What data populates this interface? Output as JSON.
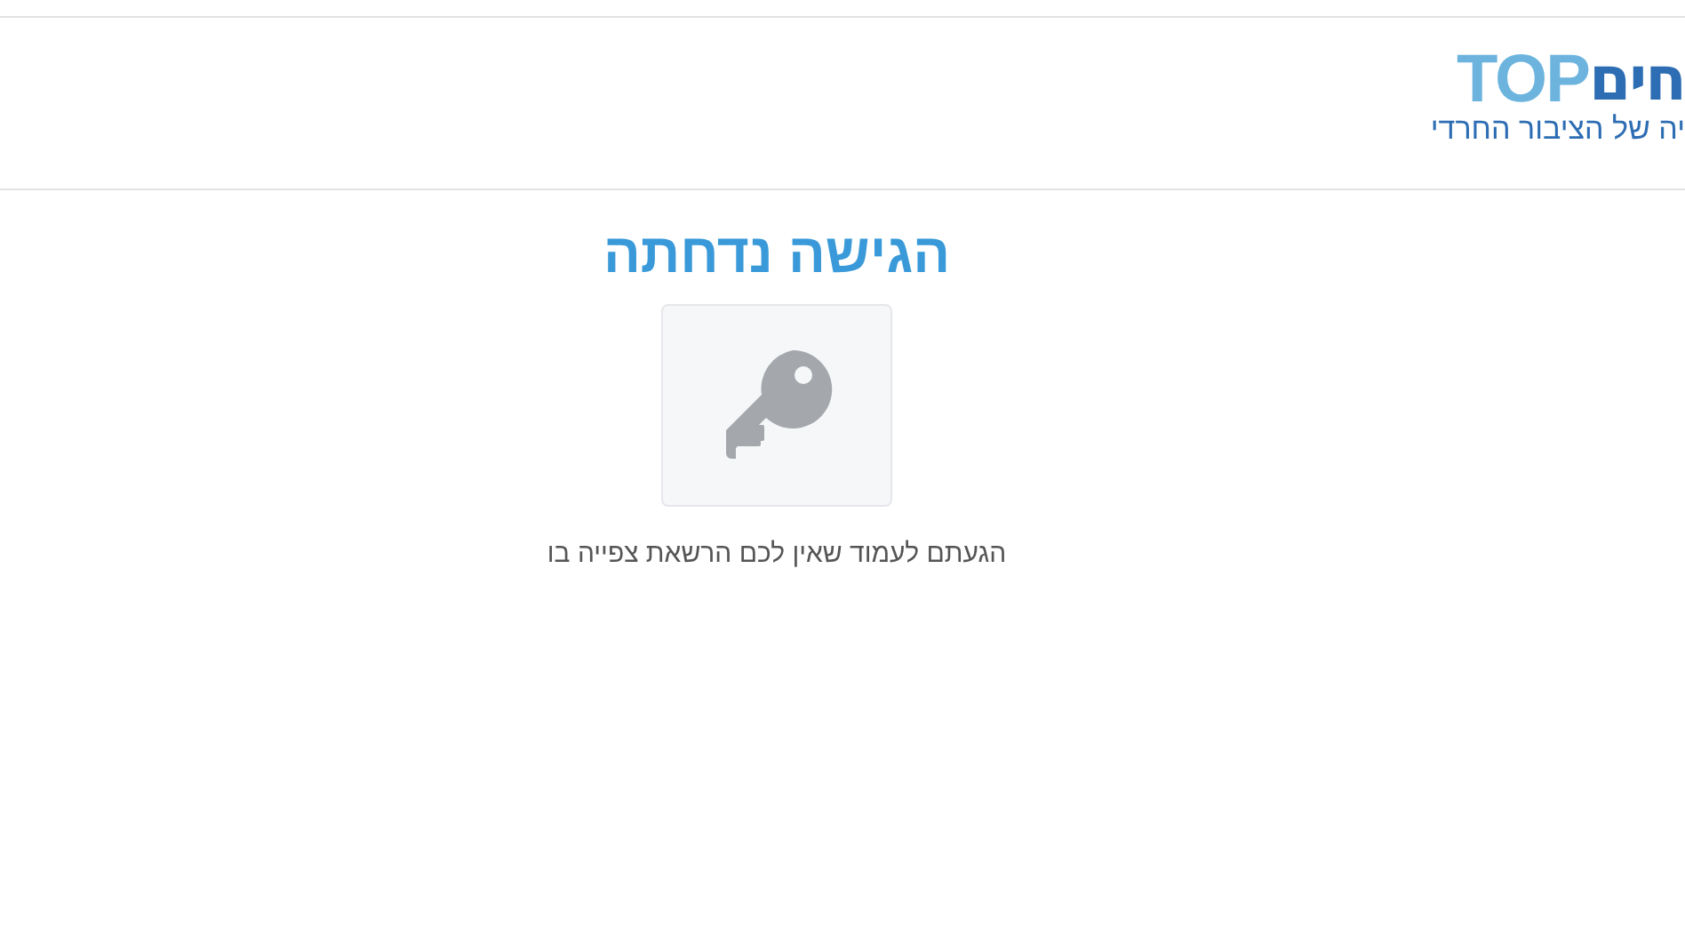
{
  "logo": {
    "latin": "TOP",
    "hebrew": "חים",
    "tagline": "יה של הציבור החרדי"
  },
  "title": "הגישה נדחתה",
  "message": "הגעתם לעמוד שאין לכם הרשאת צפייה בו"
}
